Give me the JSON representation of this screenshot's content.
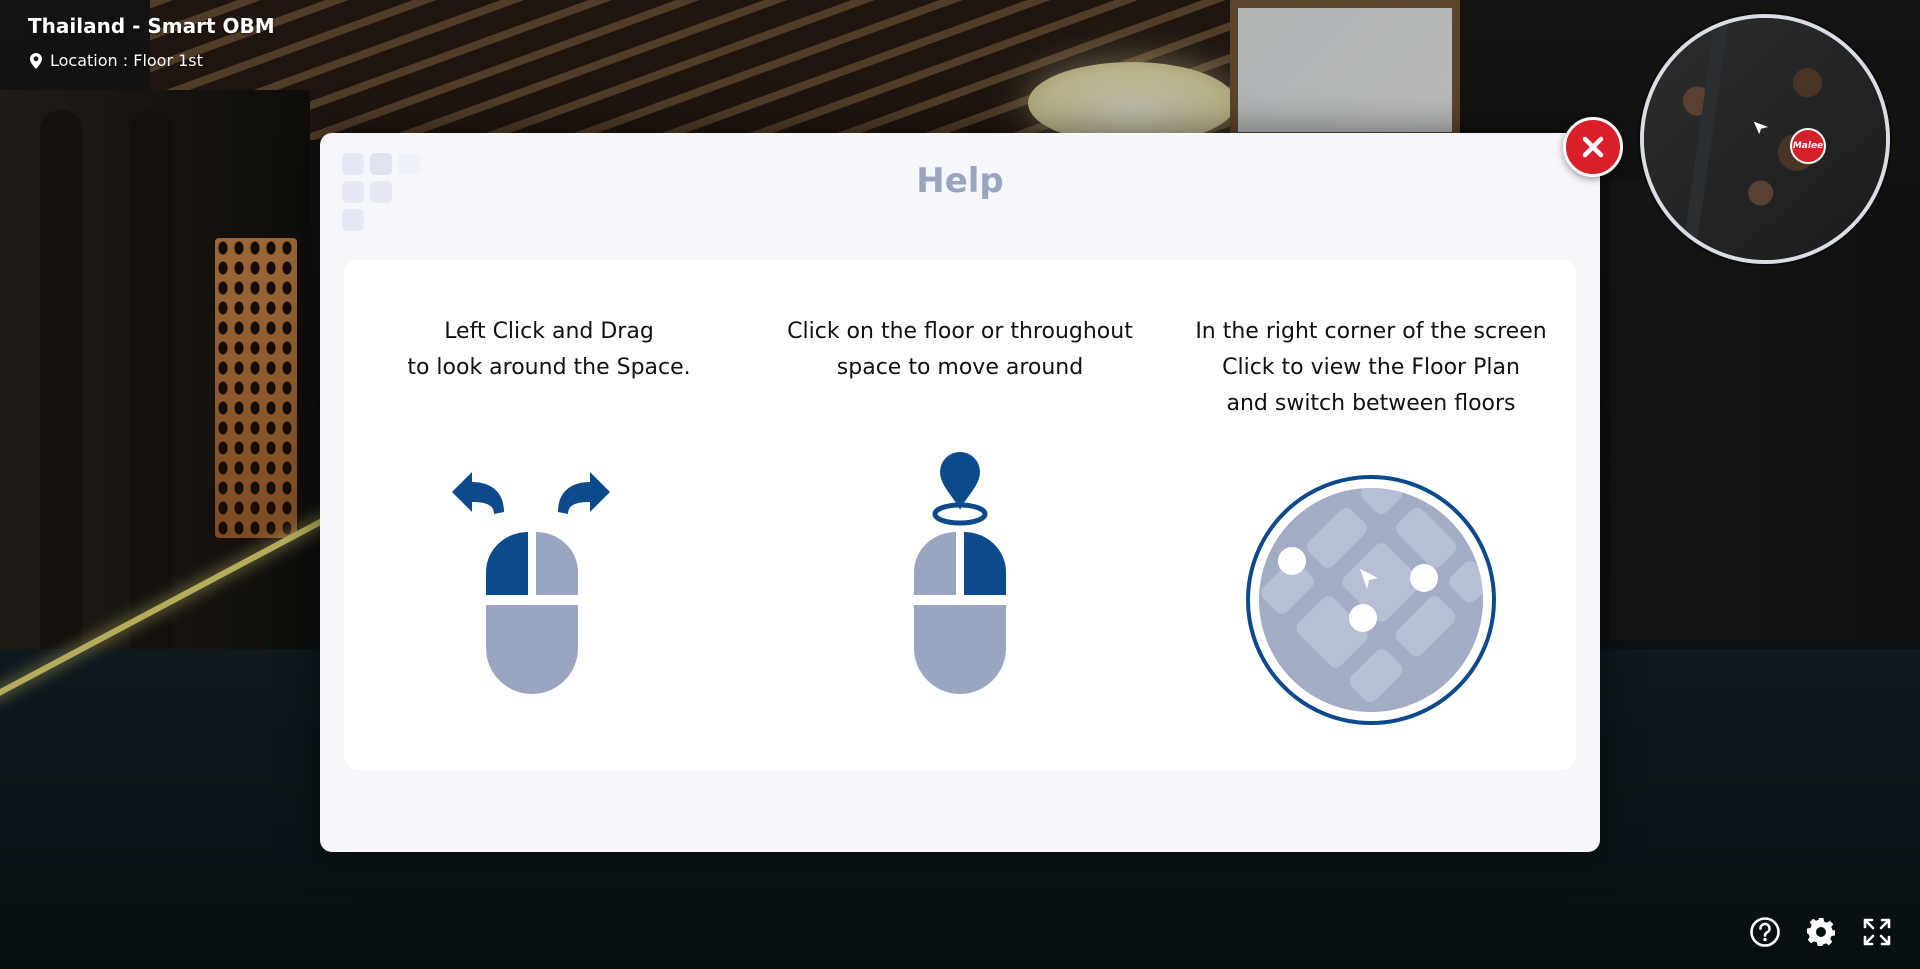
{
  "header": {
    "title": "Thailand - Smart OBM",
    "location": "Location : Floor 1st"
  },
  "minimap": {
    "badge_text": "Malee"
  },
  "help": {
    "title": "Help",
    "columns": [
      {
        "lines": [
          "Left Click and Drag",
          "to look around the Space."
        ],
        "icon": "mouse-left-drag-icon"
      },
      {
        "lines": [
          "Click on the floor or throughout",
          "space to move around"
        ],
        "icon": "mouse-click-move-icon"
      },
      {
        "lines": [
          "In the right corner of the screen",
          "Click to view the Floor Plan",
          "and switch between floors"
        ],
        "icon": "floor-plan-map-icon"
      }
    ]
  },
  "controls": {
    "help_icon": "help-icon",
    "settings_icon": "gear-icon",
    "fullscreen_icon": "fullscreen-icon"
  },
  "colors": {
    "accent_blue": "#0d4a8c",
    "muted_blue": "#9aa5c0",
    "close_red": "#d81f2a"
  }
}
